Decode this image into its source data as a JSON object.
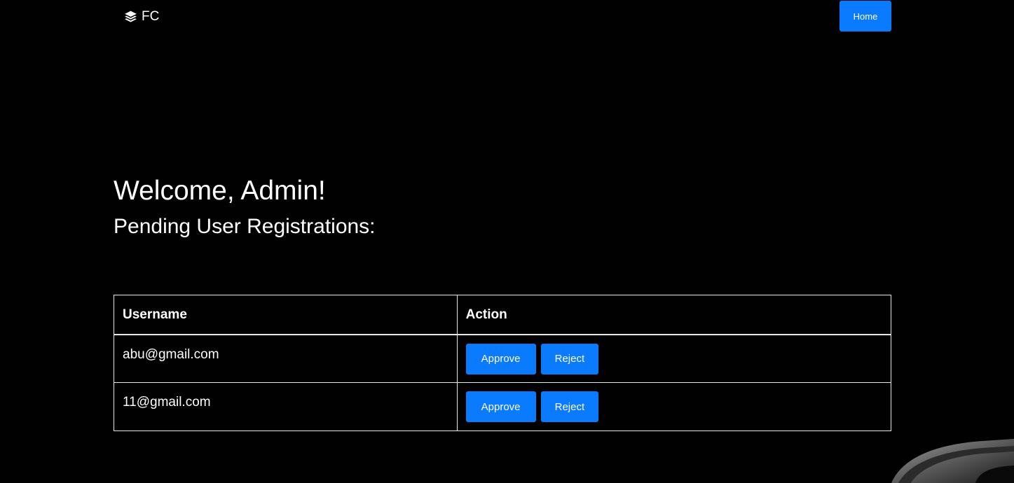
{
  "navbar": {
    "brand_text": "FC",
    "brand_icon": "layers-icon",
    "home_label": "Home"
  },
  "main": {
    "welcome": "Welcome, Admin!",
    "subtitle": "Pending User Registrations:"
  },
  "table": {
    "headers": [
      "Username",
      "Action"
    ],
    "rows": [
      {
        "username": "abu@gmail.com",
        "approve": "Approve",
        "reject": "Reject"
      },
      {
        "username": "11@gmail.com",
        "approve": "Approve",
        "reject": "Reject"
      }
    ]
  },
  "colors": {
    "background": "#020102",
    "accent": "#0a7aff",
    "text": "#ffffff"
  }
}
